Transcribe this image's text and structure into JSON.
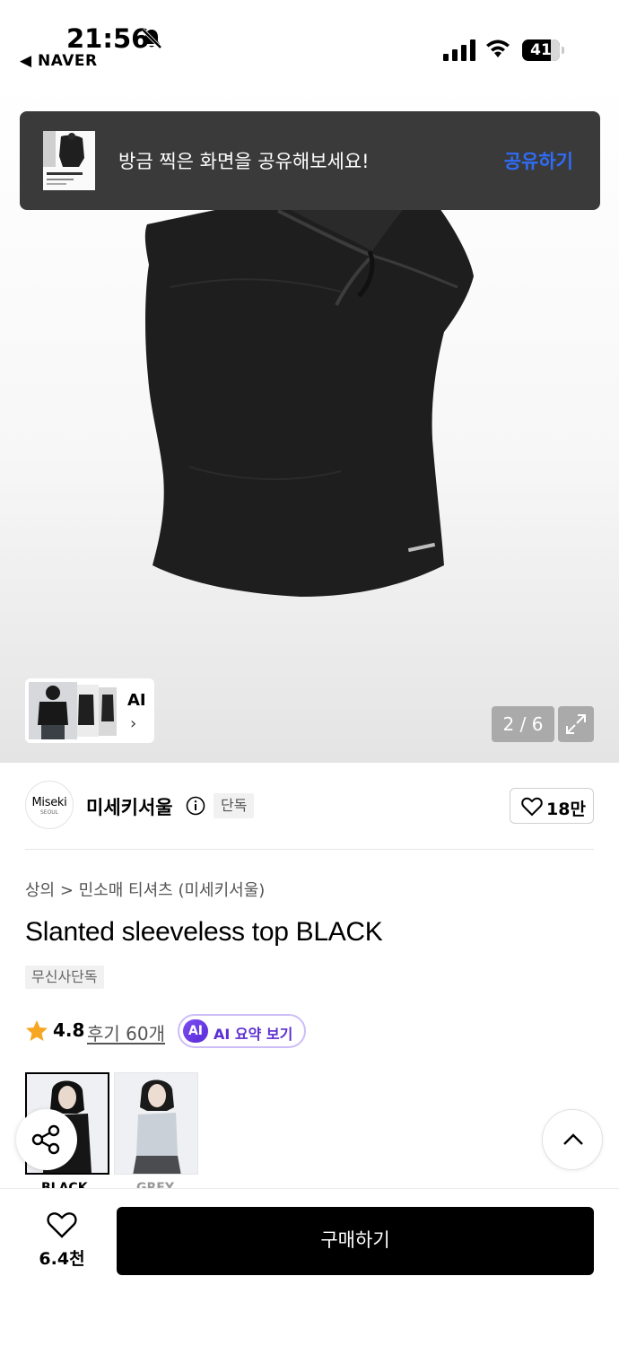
{
  "status_bar": {
    "time": "21:56",
    "back_app": "◀ NAVER",
    "battery": "41"
  },
  "toast": {
    "message": "방금 찍은 화면을 공유해보세요!",
    "action": "공유하기"
  },
  "gallery": {
    "ai_label": "AI",
    "ai_chevron": "›",
    "page_counter": "2 / 6"
  },
  "brand": {
    "logo_line1": "Miseki",
    "logo_line2": "SEOUL",
    "name": "미세키서울",
    "tag": "단독",
    "likes": "18만"
  },
  "product": {
    "breadcrumb": "상의 > 민소매 티셔츠 (미세키서울)",
    "title": "Slanted sleeveless top BLACK",
    "badge": "무신사단독",
    "rating": "4.8",
    "reviews": "후기 60개",
    "ai_summary_icon": "AI",
    "ai_summary": "AI 요약 보기"
  },
  "color_options": [
    {
      "label": "BLACK"
    },
    {
      "label": "GREY"
    }
  ],
  "bottom_bar": {
    "wish_count": "6.4천",
    "buy_label": "구매하기"
  },
  "colors": {
    "toast_bg": "#3a3a3b",
    "toast_action": "#2f6cf6",
    "ai_purple": "#5b2fd1",
    "star": "#f6a623",
    "buy_bg": "#000000"
  },
  "icons": [
    "bell-slash-icon",
    "signal-icon",
    "wifi-icon",
    "battery-icon",
    "info-icon",
    "heart-icon",
    "star-icon",
    "share-icon",
    "chevron-up-icon",
    "expand-icon",
    "chevron-right-icon"
  ]
}
